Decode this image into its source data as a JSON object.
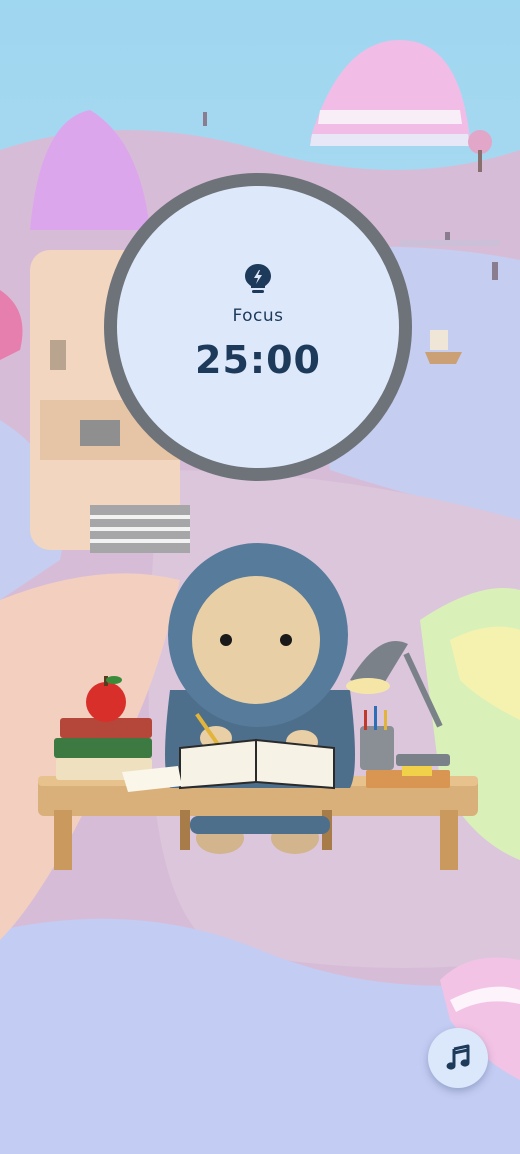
{
  "timer": {
    "mode_label": "Focus",
    "mode_icon": "lightbulb-bolt-icon",
    "time": "25:00"
  },
  "controls": {
    "music_icon": "music-note-icon"
  },
  "colors": {
    "ring": "#6e7379",
    "dial": "#dde9fb",
    "text": "#1e3a5a",
    "music_button": "#dbe8fb"
  }
}
